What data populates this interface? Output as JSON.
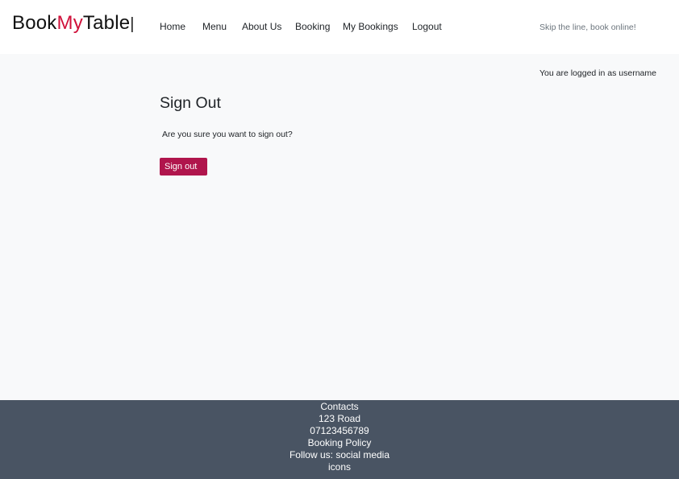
{
  "header": {
    "brand": {
      "part1": "Book",
      "part2": "My",
      "part3": "Table",
      "separator": "|"
    },
    "nav": [
      {
        "label": "Home"
      },
      {
        "label": "Menu"
      },
      {
        "label": "About Us"
      },
      {
        "label": "Booking"
      },
      {
        "label": "My Bookings"
      },
      {
        "label": "Logout"
      }
    ],
    "tagline": "Skip the line, book online!"
  },
  "main": {
    "login_status": "You are logged in as username",
    "title": "Sign Out",
    "confirm_text": "Are you sure you want to sign out?",
    "signout_label": "Sign out"
  },
  "footer": {
    "contacts": "Contacts",
    "address": "123 Road",
    "phone": "07123456789",
    "policy": "Booking Policy",
    "social": "Follow us: social media icons"
  },
  "colors": {
    "brand_accent": "#d0103a",
    "button": "#b0154c",
    "footer_bg": "#495463",
    "page_bg": "#f8f9fa"
  }
}
